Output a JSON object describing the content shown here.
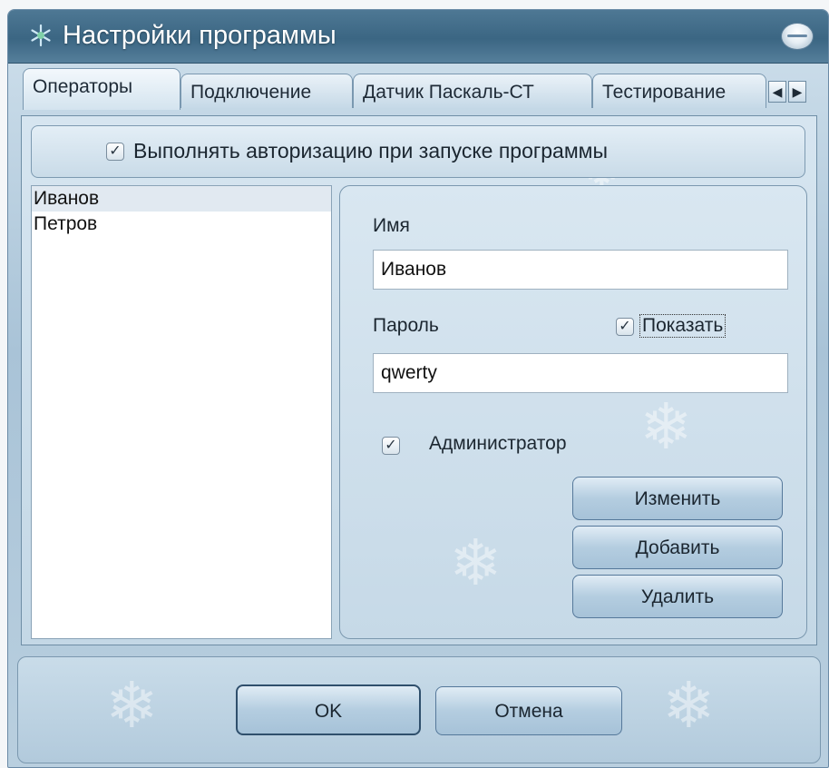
{
  "window": {
    "title": "Настройки программы",
    "icon": "snowflake-icon",
    "minimize_icon": "minimize-icon"
  },
  "tabs": [
    {
      "label": "Операторы",
      "active": true
    },
    {
      "label": "Подключение",
      "active": false
    },
    {
      "label": "Датчик Паскаль-СТ",
      "active": false
    },
    {
      "label": "Тестирование",
      "active": false
    }
  ],
  "tab_scroll": {
    "left": "◀",
    "right": "▶"
  },
  "auth": {
    "checked": true,
    "label": "Выполнять авторизацию при запуске программы"
  },
  "operators": [
    "Иванов",
    "Петров"
  ],
  "selected_operator": "Иванов",
  "form": {
    "name_label": "Имя",
    "name_value": "Иванов",
    "password_label": "Пароль",
    "show_label": "Показать",
    "show_checked": true,
    "password_value": "qwerty",
    "admin_label": "Администратор",
    "admin_checked": true,
    "edit_button": "Изменить",
    "add_button": "Добавить",
    "delete_button": "Удалить"
  },
  "footer": {
    "ok_button": "OK",
    "cancel_button": "Отмена"
  },
  "colors": {
    "titlebar": "#3b6683",
    "accent": "#55789a"
  }
}
